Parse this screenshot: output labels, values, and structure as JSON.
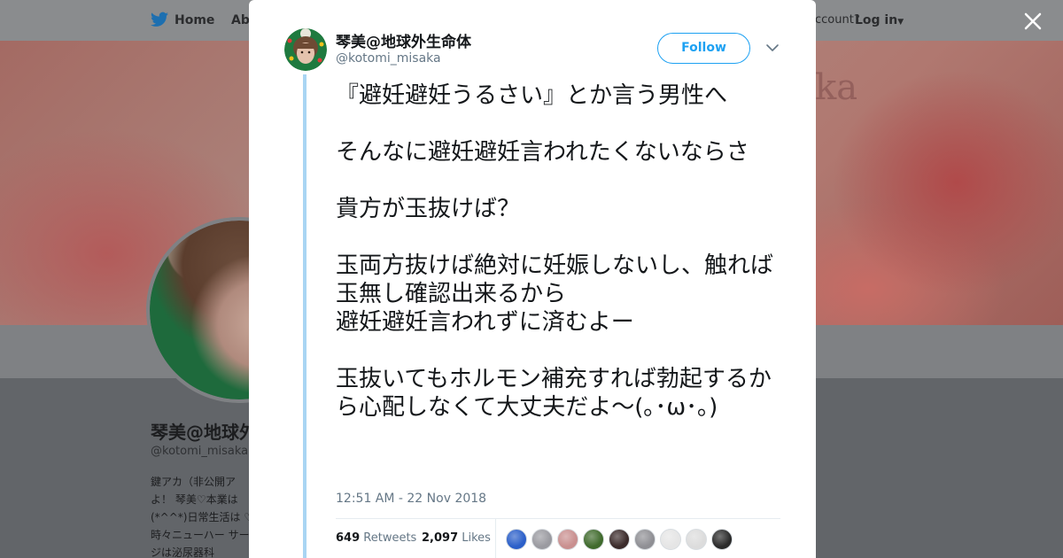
{
  "background": {
    "nav": {
      "home": "Home",
      "about": "Abo",
      "account": "ccount?",
      "login": "Log in"
    },
    "banner_watermark": "ka",
    "profile_name": "琴美@地球外",
    "profile_handle": "@kotomi_misaka",
    "bio": "鍵アカ（非公開ア よ！ 琴美♡本業は (*^^*)日常生活は ♡時々ニューハー サージは泌尿器科"
  },
  "modal": {
    "author": {
      "name": "琴美@地球外生命体",
      "handle": "@kotomi_misaka"
    },
    "follow_label": "Follow",
    "tweet_text": "『避妊避妊うるさい』とか言う男性へ\n\nそんなに避妊避妊言われたくないならさ\n\n貴方が玉抜けば？\n\n玉両方抜けば絶対に妊娠しないし、触れば玉無し確認出来るから\n避妊避妊言われずに済むよー\n\n玉抜いてもホルモン補充すれば勃起するから心配しなくて大丈夫だよ～(｡･ω･｡)",
    "timestamp": "12:51 AM - 22 Nov 2018",
    "retweets": {
      "count": "649",
      "label": "Retweets"
    },
    "likes": {
      "count": "2,097",
      "label": "Likes"
    },
    "liker_colors": [
      "#2b5fc9",
      "#9a9aa0",
      "#c98f8f",
      "#3f6a2c",
      "#3a2a2a",
      "#8f8f94",
      "#e5e5e5",
      "#dcdcdc",
      "#2a2a2a"
    ]
  },
  "colors": {
    "accent": "#1da1f2",
    "thread": "#a9d5f3",
    "text": "#14171a",
    "muted": "#657786"
  }
}
